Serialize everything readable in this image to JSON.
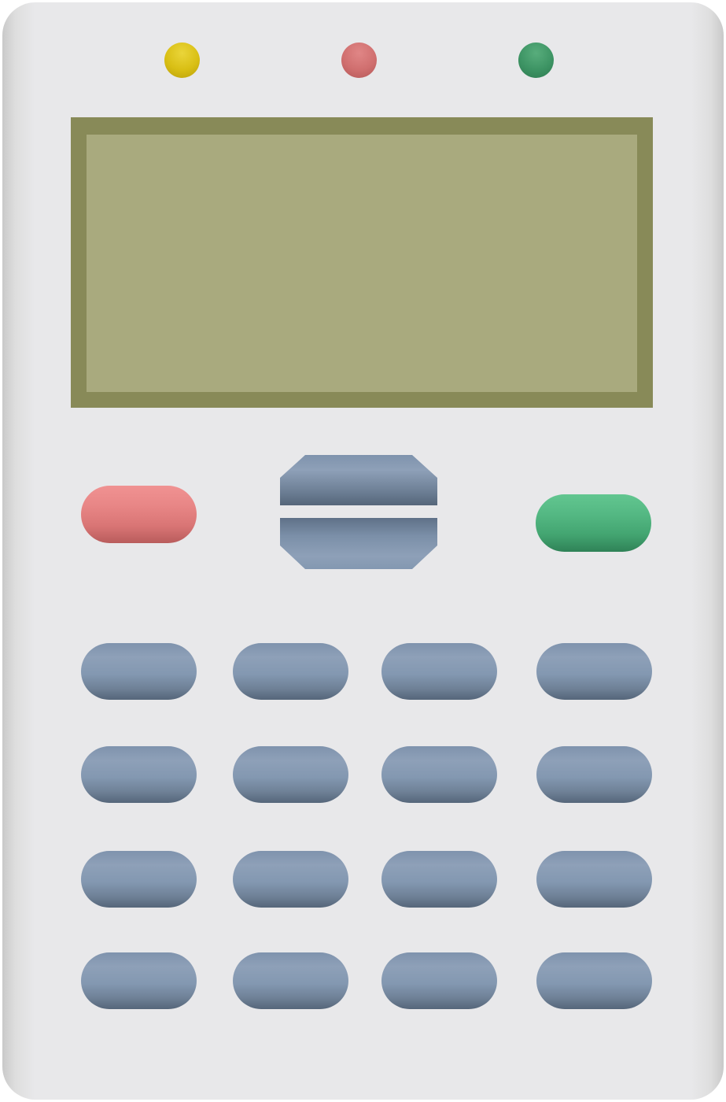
{
  "device": {
    "indicators": [
      {
        "name": "yellow",
        "color": "#d9bf14"
      },
      {
        "name": "red",
        "color": "#d06f6f"
      },
      {
        "name": "green",
        "color": "#3d9464"
      }
    ],
    "screen": {
      "text": "",
      "border_color": "#888a58",
      "fill_color": "#a9aa7e"
    },
    "soft_keys": {
      "left": {
        "color": "#e88686",
        "icon": "red-pill-key"
      },
      "right": {
        "color": "#54b883",
        "icon": "green-pill-key"
      }
    },
    "nav_key": {
      "color": "#8ea0b8",
      "icon": "up-down-rocker"
    },
    "keypad": {
      "rows": 4,
      "columns": 4,
      "color": "#8398b1"
    }
  }
}
